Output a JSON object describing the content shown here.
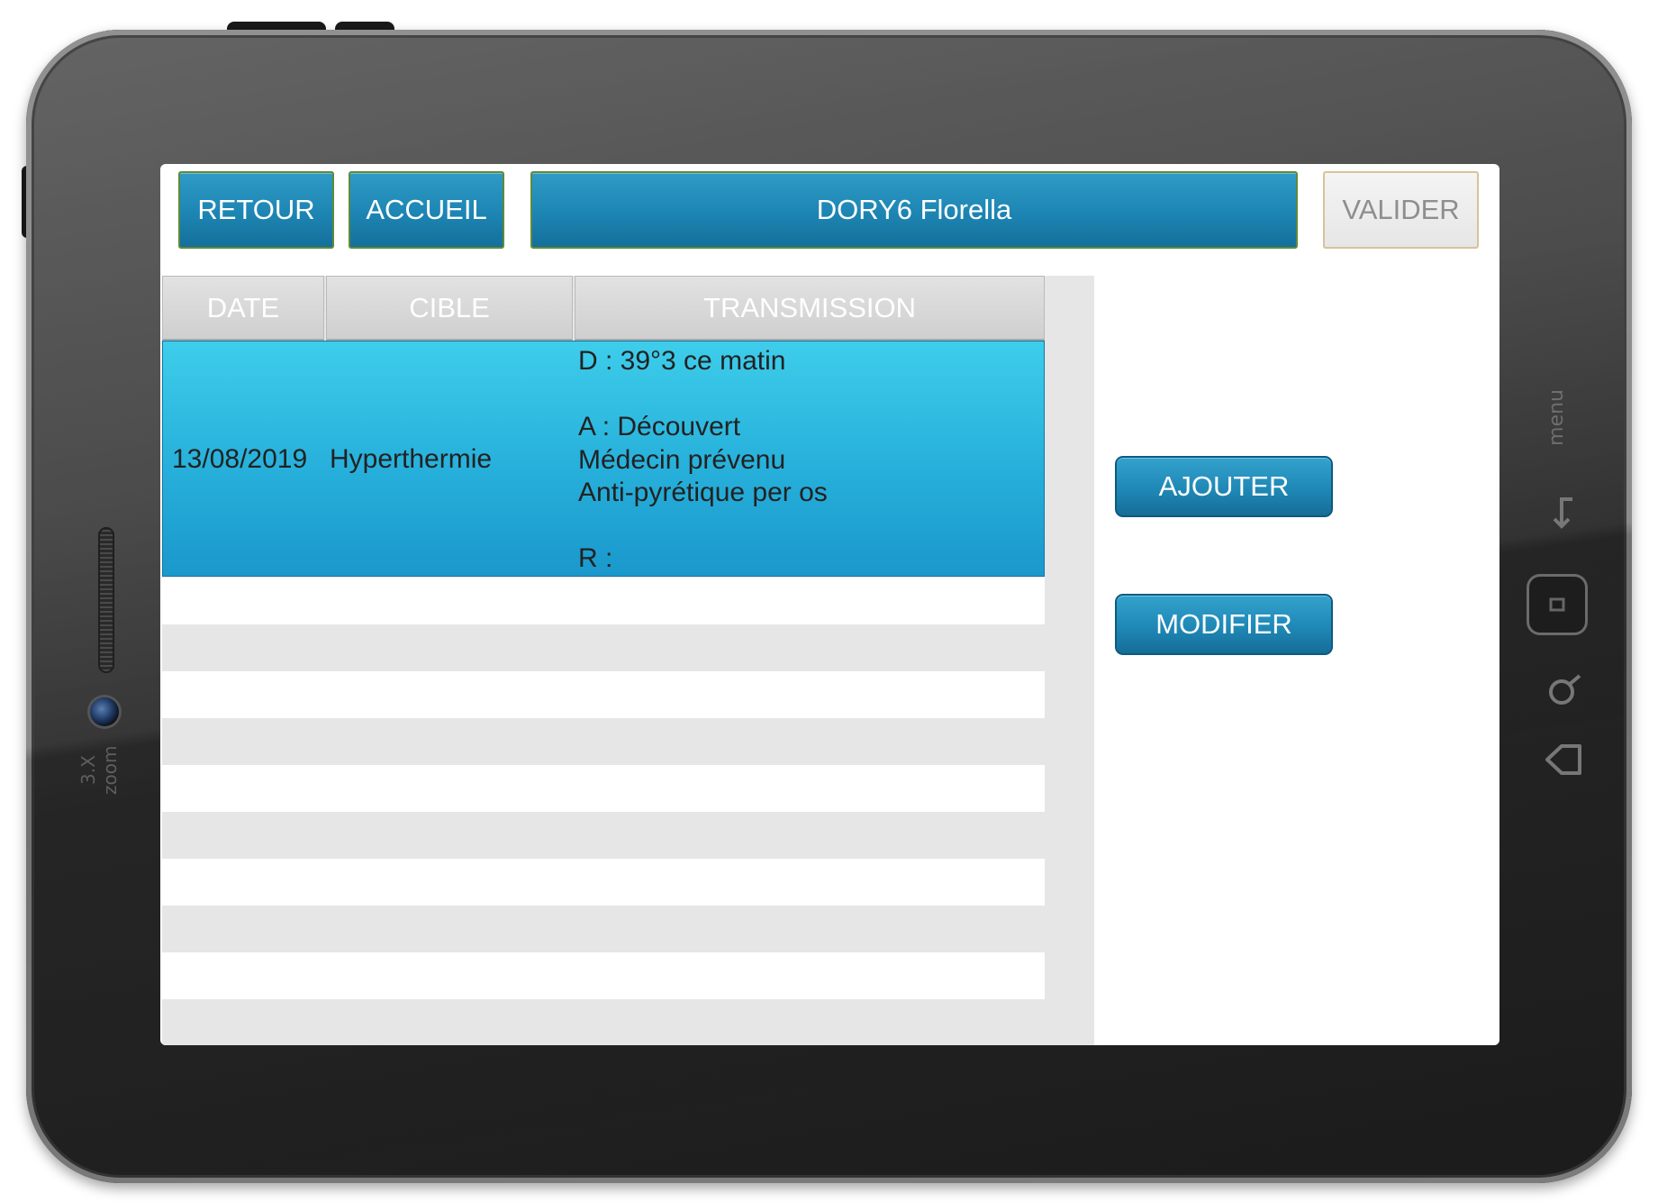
{
  "device": {
    "camera_label": "3.X zoom",
    "menu_label": "menu"
  },
  "toolbar": {
    "back_label": "RETOUR",
    "home_label": "ACCUEIL",
    "patient_name": "DORY6 Florella",
    "validate_label": "VALIDER"
  },
  "table": {
    "columns": [
      "DATE",
      "CIBLE",
      "TRANSMISSION"
    ],
    "rows": [
      {
        "date": "13/08/2019",
        "cible": "Hyperthermie",
        "transmission": [
          "D : 39°3 ce matin",
          "",
          "A : Découvert",
          "Médecin prévenu",
          "Anti-pyrétique per os",
          "",
          "R :"
        ]
      }
    ]
  },
  "actions": {
    "add_label": "AJOUTER",
    "modify_label": "MODIFIER"
  },
  "colors": {
    "button_blue": "#1d85b3",
    "selected_row": "#28b2dc",
    "header_gray": "#d6d6d6"
  }
}
